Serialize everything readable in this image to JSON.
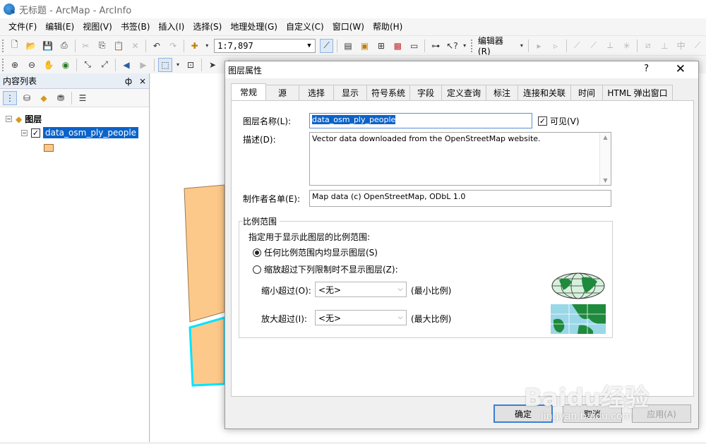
{
  "window": {
    "title": "无标题 - ArcMap - ArcInfo"
  },
  "menu": [
    "文件(F)",
    "编辑(E)",
    "视图(V)",
    "书签(B)",
    "插入(I)",
    "选择(S)",
    "地理处理(G)",
    "自定义(C)",
    "窗口(W)",
    "帮助(H)"
  ],
  "toolbar": {
    "scale_value": "1:7,897",
    "editor_label": "编辑器(R)"
  },
  "toc": {
    "title": "内容列表",
    "pin": "ф",
    "close": "×",
    "group_label": "图层",
    "layer_name": "data_osm_ply_people"
  },
  "dialog": {
    "title": "图层属性",
    "help": "?",
    "close": "✕",
    "tabs": [
      "常规",
      "源",
      "选择",
      "显示",
      "符号系统",
      "字段",
      "定义查询",
      "标注",
      "连接和关联",
      "时间",
      "HTML 弹出窗口"
    ],
    "layer_name_label": "图层名称(L):",
    "layer_name_value": "data_osm_ply_people",
    "visible_label": "可见(V)",
    "description_label": "描述(D):",
    "description_value": "Vector data downloaded from the OpenStreetMap website.",
    "credits_label": "制作者名单(E):",
    "credits_value": "Map data (c) OpenStreetMap, ODbL 1.0",
    "scale_group_title": "比例范围",
    "scale_instruction": "指定用于显示此图层的比例范围:",
    "radio_any": "任何比例范围内均显示图层(S)",
    "radio_limit": "缩放超过下列限制时不显示图层(Z):",
    "min_label": "缩小超过(O):",
    "min_value": "<无>",
    "min_hint": "(最小比例)",
    "max_label": "放大超过(I):",
    "max_value": "<无>",
    "max_hint": "(最大比例)",
    "ok": "确定",
    "cancel": "取消",
    "apply": "应用(A)"
  },
  "watermark": {
    "main": "Baidu经验",
    "sub": "jingyan.baidu.com"
  },
  "colors": {
    "selection": "#0b63c9",
    "polygon_fill": "#fdc98a",
    "polygon_highlight": "#00e5ff"
  }
}
